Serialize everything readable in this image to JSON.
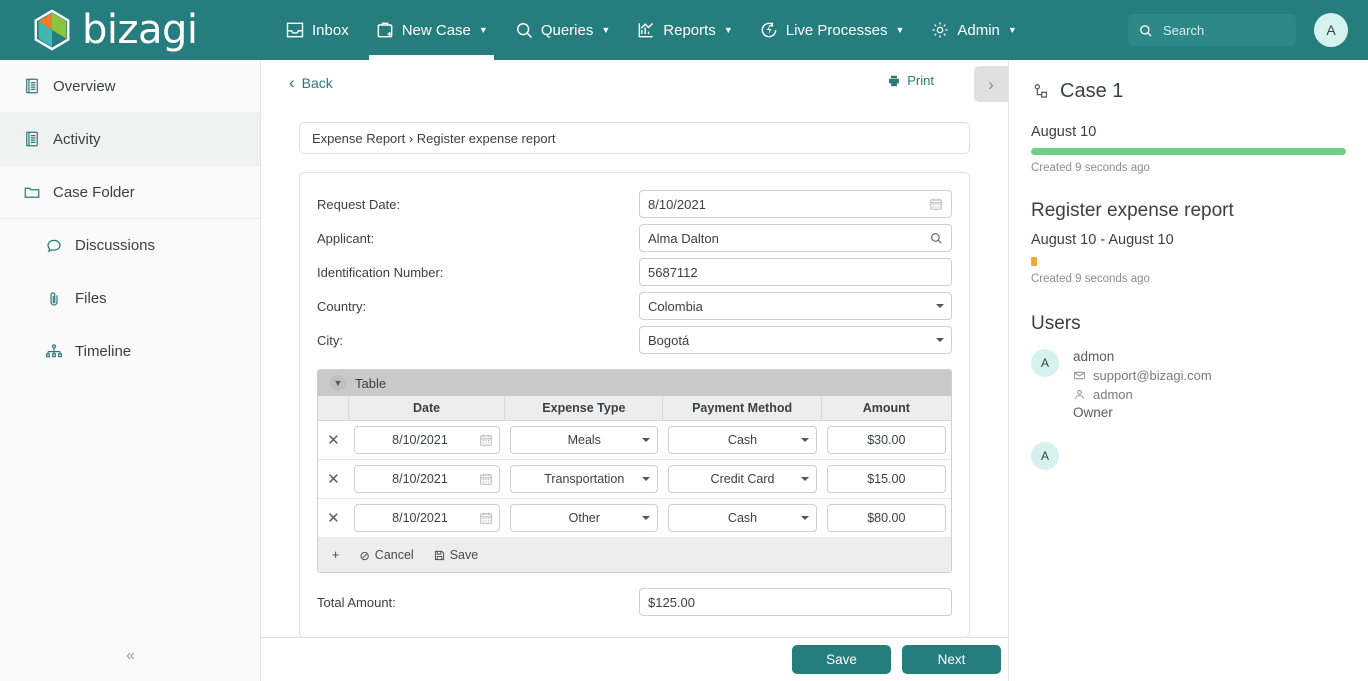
{
  "brand": {
    "name": "bizagi"
  },
  "topnav": {
    "items": [
      {
        "label": "Inbox",
        "icon": "inbox-icon",
        "caret": false,
        "active": false
      },
      {
        "label": "New Case",
        "icon": "new-case-icon",
        "caret": true,
        "active": true
      },
      {
        "label": "Queries",
        "icon": "search-icon",
        "caret": true,
        "active": false
      },
      {
        "label": "Reports",
        "icon": "reports-chart-icon",
        "caret": true,
        "active": false
      },
      {
        "label": "Live Processes",
        "icon": "live-processes-icon",
        "caret": true,
        "active": false
      },
      {
        "label": "Admin",
        "icon": "gear-icon",
        "caret": true,
        "active": false
      }
    ],
    "caret_glyph": "▼"
  },
  "search": {
    "placeholder": "Search",
    "value": ""
  },
  "user_menu": {
    "initial": "A"
  },
  "sidebar": {
    "items": [
      {
        "label": "Overview",
        "icon": "document-list-icon",
        "active": false,
        "sub": false
      },
      {
        "label": "Activity",
        "icon": "document-list-icon",
        "active": true,
        "sub": false
      },
      {
        "label": "Case Folder",
        "icon": "folder-icon",
        "active": false,
        "sub": false
      },
      {
        "label": "Discussions",
        "icon": "comment-icon",
        "active": false,
        "sub": true
      },
      {
        "label": "Files",
        "icon": "paperclip-icon",
        "active": false,
        "sub": true
      },
      {
        "label": "Timeline",
        "icon": "timeline-icon",
        "active": false,
        "sub": true
      }
    ],
    "collapse_glyph": "«"
  },
  "main": {
    "back_label": "Back",
    "back_glyph": "‹",
    "print_label": "Print",
    "panel_toggle_glyph": "›",
    "breadcrumb": "Expense Report › Register expense report",
    "fields": [
      {
        "label": "Request Date:",
        "value": "8/10/2021",
        "control": "date"
      },
      {
        "label": "Applicant:",
        "value": "Alma Dalton",
        "control": "lookup"
      },
      {
        "label": "Identification Number:",
        "value": "5687112",
        "control": "text"
      },
      {
        "label": "Country:",
        "value": "Colombia",
        "control": "select"
      },
      {
        "label": "City:",
        "value": "Bogotá",
        "control": "select"
      }
    ],
    "table": {
      "title": "Table",
      "columns": [
        "",
        "Date",
        "Expense Type",
        "Payment Method",
        "Amount"
      ],
      "rows": [
        {
          "date": "8/10/2021",
          "expense_type": "Meals",
          "payment_method": "Cash",
          "amount": "$30.00"
        },
        {
          "date": "8/10/2021",
          "expense_type": "Transportation",
          "payment_method": "Credit Card",
          "amount": "$15.00"
        },
        {
          "date": "8/10/2021",
          "expense_type": "Other",
          "payment_method": "Cash",
          "amount": "$80.00"
        }
      ],
      "footer": {
        "add_label": "+",
        "cancel_label": "Cancel",
        "save_label": "Save"
      },
      "delete_glyph": "✕"
    },
    "total": {
      "label": "Total Amount:",
      "value": "$125.00"
    },
    "actions": {
      "save_label": "Save",
      "next_label": "Next"
    }
  },
  "right_panel": {
    "case_title": "Case 1",
    "case_date": "August 10",
    "case_created": "Created 9 seconds ago",
    "activity_title": "Register expense report",
    "activity_date": "August 10 - August 10",
    "activity_created": "Created 9 seconds ago",
    "users_title": "Users",
    "users": [
      {
        "initial": "A",
        "name": "admon",
        "email": "support@bizagi.com",
        "account": "admon",
        "role": "Owner"
      },
      {
        "initial": "A",
        "name": "",
        "email": "",
        "account": "",
        "role": ""
      }
    ]
  },
  "colors": {
    "brand_teal": "#257d7d",
    "accent_teal": "#2b7a78",
    "green_bar": "#6ece87",
    "orange_bar": "#f0a73a",
    "avatar_bg": "#d6f2ef"
  }
}
